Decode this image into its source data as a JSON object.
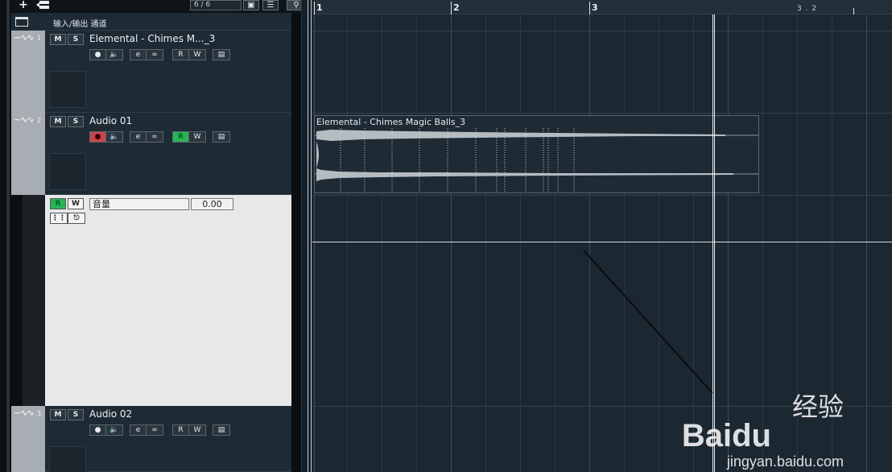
{
  "toolbar": {
    "add_icon": "plus-icon",
    "track_counter": "6 / 6"
  },
  "io_row": {
    "label": "输入/输出 通道"
  },
  "tracks": [
    {
      "number": "1",
      "name": "Elemental - Chimes M..._3",
      "m": "M",
      "s": "S",
      "r": "R",
      "w": "W",
      "record_armed": false,
      "read_on": false
    },
    {
      "number": "2",
      "name": "Audio 01",
      "m": "M",
      "s": "S",
      "r": "R",
      "w": "W",
      "record_armed": true,
      "read_on": true
    },
    {
      "number": "3",
      "name": "Audio 02",
      "m": "M",
      "s": "S",
      "r": "R",
      "w": "W",
      "record_armed": false,
      "read_on": false
    }
  ],
  "automation": {
    "r": "R",
    "w": "W",
    "parameter": "音量",
    "value": "0.00"
  },
  "ruler": {
    "bars": [
      "1",
      "2",
      "3"
    ],
    "sub_label": "3 . 2"
  },
  "event": {
    "name": "Elemental - Chimes Magic Balls_3"
  },
  "watermark": {
    "logo": "Bai",
    "logo2": "du",
    "cn": "经验",
    "url": "jingyan.baidu.com"
  },
  "colors": {
    "record": "#c8454f",
    "read": "#29b356",
    "background": "#1b2731"
  }
}
